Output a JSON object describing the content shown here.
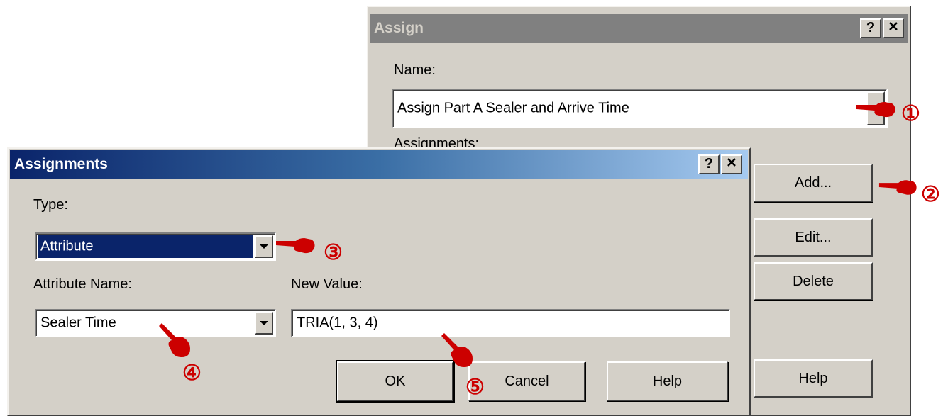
{
  "assign_dialog": {
    "title": "Assign",
    "help_btn": "?",
    "close_btn": "✕",
    "name_label": "Name:",
    "name_value": "Assign Part A Sealer and Arrive Time",
    "assignments_label": "Assignments:",
    "add_label": "Add...",
    "edit_label": "Edit...",
    "delete_label": "Delete",
    "help_label": "Help"
  },
  "assignments_dialog": {
    "title": "Assignments",
    "help_btn": "?",
    "close_btn": "✕",
    "type_label": "Type:",
    "type_value": "Attribute",
    "attr_name_label": "Attribute Name:",
    "attr_name_value": "Sealer Time",
    "new_value_label": "New Value:",
    "new_value_value": "TRIA(1, 3, 4)",
    "ok_label": "OK",
    "cancel_label": "Cancel",
    "help_label": "Help"
  },
  "annotations": {
    "n1": "①",
    "n2": "②",
    "n3": "③",
    "n4": "④",
    "n5": "⑤",
    "pointer_icon": "pointing-hand-icon",
    "annotation_color": "#cc0000"
  },
  "colors": {
    "dialog_bg": "#d4d0c8",
    "active_title_start": "#0a246a",
    "active_title_end": "#a6caf0",
    "inactive_title": "#808080",
    "selection": "#0a246a"
  }
}
